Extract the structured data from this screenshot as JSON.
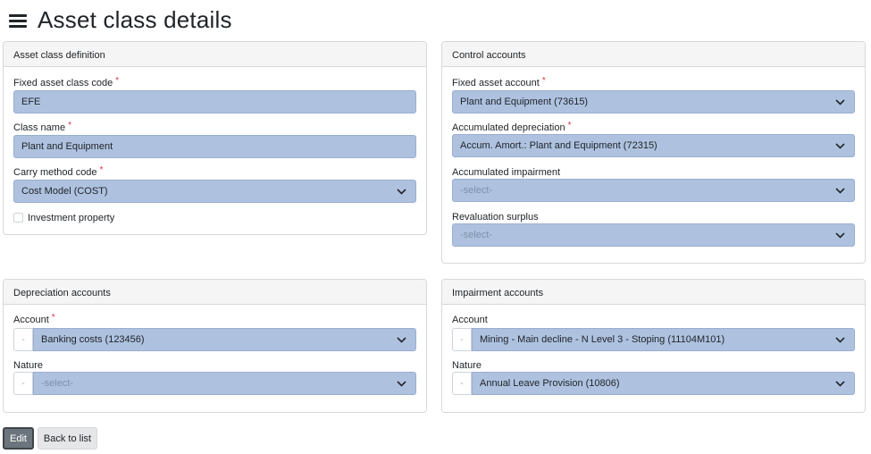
{
  "page": {
    "title": "Asset class details"
  },
  "definition": {
    "header": "Asset class definition",
    "code_label": "Fixed asset class code",
    "code_value": "EFE",
    "name_label": "Class name",
    "name_value": "Plant and Equipment",
    "carry_label": "Carry method code",
    "carry_value": "Cost Model (COST)",
    "investment_label": "Investment property",
    "required_mark": "*"
  },
  "control": {
    "header": "Control accounts",
    "fixed_label": "Fixed asset account",
    "fixed_value": "Plant and Equipment (73615)",
    "accdep_label": "Accumulated depreciation",
    "accdep_value": "Accum. Amort.: Plant and Equipment (72315)",
    "impair_label": "Accumulated impairment",
    "impair_value": "-select-",
    "reval_label": "Revaluation surplus",
    "reval_value": "-select-"
  },
  "depreciation": {
    "header": "Depreciation accounts",
    "account_label": "Account",
    "account_value": "Banking costs (123456)",
    "nature_label": "Nature",
    "nature_value": "-select-",
    "lookup_symbol": "-"
  },
  "impairment": {
    "header": "Impairment accounts",
    "account_label": "Account",
    "account_value": "Mining - Main decline - N Level 3 - Stoping (11104M101)",
    "nature_label": "Nature",
    "nature_value": "Annual Leave Provision (10806)",
    "lookup_symbol": "-"
  },
  "actions": {
    "edit_label": "Edit",
    "back_label": "Back to list"
  },
  "colors": {
    "field_bg": "#aec2e0",
    "required": "#dc3545",
    "edit_btn": "#6c757d"
  }
}
